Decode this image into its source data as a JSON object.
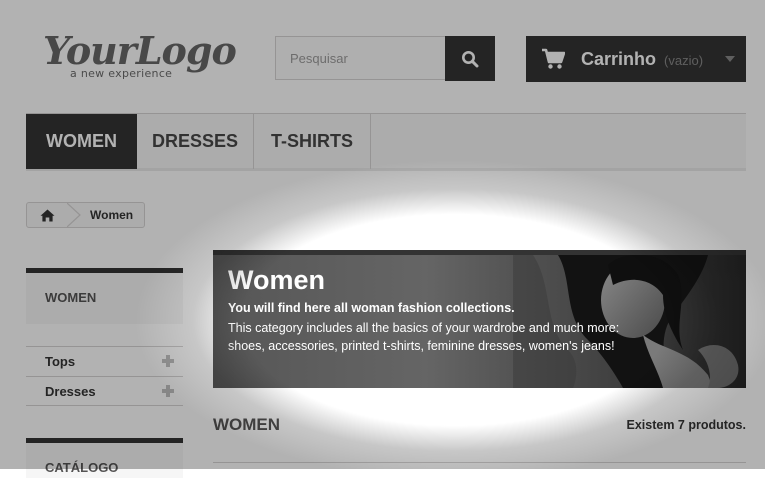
{
  "logo": {
    "text": "YourLogo",
    "tagline": "a new experience"
  },
  "search": {
    "placeholder": "Pesquisar",
    "value": "",
    "button_icon": "search-icon"
  },
  "cart": {
    "label": "Carrinho",
    "status": "(vazio)",
    "icon": "shopping-cart-icon"
  },
  "menu": {
    "items": [
      {
        "label": "WOMEN"
      },
      {
        "label": "DRESSES"
      },
      {
        "label": "T-SHIRTS"
      }
    ],
    "active": "WOMEN"
  },
  "breadcrumb": {
    "home_icon": "home-icon",
    "current": "Women"
  },
  "sidebar": {
    "category_title": "WOMEN",
    "subcategories": [
      {
        "label": "Tops"
      },
      {
        "label": "Dresses"
      }
    ],
    "catalog_title": "CATÁLOGO"
  },
  "banner": {
    "title": "Women",
    "line1": "You will find here all woman fashion collections.",
    "line2": "This category includes all the basics of your wardrobe and much more:",
    "line3": "shoes, accessories, printed t-shirts, feminine dresses, women's jeans!"
  },
  "listing": {
    "heading": "WOMEN",
    "count_text": "Existem 7 produtos."
  },
  "colors": {
    "dark": "#333333",
    "panel": "#f6f6f6",
    "border": "#d6d4d4",
    "text": "#555454"
  }
}
